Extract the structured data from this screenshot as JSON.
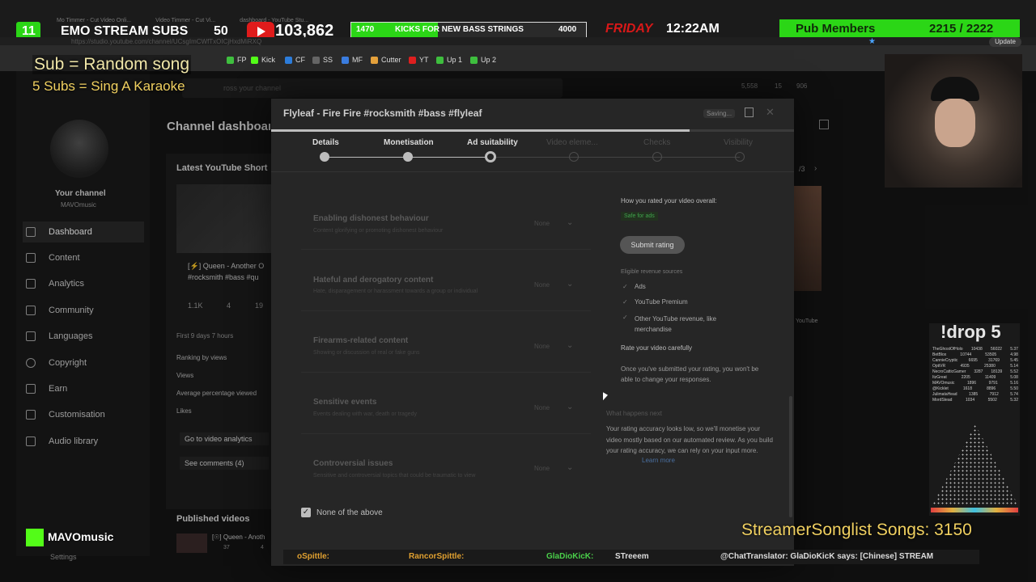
{
  "overlay": {
    "stream_subs": {
      "left_num": "11",
      "label": "EMO STREAM SUBS",
      "right_num": "50"
    },
    "youtube_count": "103,862",
    "kicks": {
      "left": "1470",
      "label": "KICKS FOR NEW BASS STRINGS",
      "right": "4000"
    },
    "day": "FRIDAY",
    "clock": "12:22AM",
    "pub_members": {
      "label": "Pub Members",
      "count": "2215 / 2222"
    },
    "tiny_tabs": [
      "Mo Timmer - Cut Video Onli...",
      "Video Timmer - Cut Vi...",
      "dashboard - YouTube Stu..."
    ],
    "url": "https://studio.youtube.com/channel/UCsgImCWfTxOICjHxdMiRXQ",
    "sub_line1": "Sub = Random song",
    "sub_line2": "5 Subs = Sing A Karaoke",
    "drop_title": "!drop 5",
    "leaderboard": [
      {
        "name": "TheGhostOfHolo",
        "a": "10438",
        "b": "56022",
        "c": "5.37"
      },
      {
        "name": "BetBlox",
        "a": "10744",
        "b": "53505",
        "c": "4.98"
      },
      {
        "name": "CannieCryptic",
        "a": "6695",
        "b": "31769",
        "c": "5.45"
      },
      {
        "name": "OptiVR",
        "a": "4935",
        "b": "25380",
        "c": "5.14"
      },
      {
        "name": "NecroCatticGamer",
        "a": "3287",
        "b": "18139",
        "c": "5.52"
      },
      {
        "name": "ItzGreat",
        "a": "2205",
        "b": "11409",
        "c": "5.08"
      },
      {
        "name": "MAVOmusic",
        "a": "1896",
        "b": "9791",
        "c": "5.16"
      },
      {
        "name": "@Kicklet",
        "a": "1618",
        "b": "8896",
        "c": "5.50"
      },
      {
        "name": "JulimataHead",
        "a": "1385",
        "b": "7912",
        "c": "5.74"
      },
      {
        "name": "MordStead",
        "a": "1034",
        "b": "5502",
        "c": "5.32"
      }
    ],
    "songlist": "StreamerSonglist Songs: 3150",
    "streamer_name": "MAVOmusic",
    "ticker": [
      "oSpittle:",
      "RancorSpittle:",
      "GlaDioKicK:",
      "STreeem",
      "@ChatTranslator: GlaDioKicK says: [Chinese] STREAM"
    ]
  },
  "bookmarks": [
    {
      "label": "FP",
      "color": "#3fbf3f"
    },
    {
      "label": "Kick",
      "color": "#53fc18"
    },
    {
      "label": "CF",
      "color": "#2d7ddb"
    },
    {
      "label": "SS",
      "color": "#666666"
    },
    {
      "label": "MF",
      "color": "#3b7de0"
    },
    {
      "label": "Cutter",
      "color": "#e6a23c"
    },
    {
      "label": "YT",
      "color": "#e02020"
    },
    {
      "label": "Up 1",
      "color": "#3fbf3f"
    },
    {
      "label": "Up 2",
      "color": "#3fbf3f"
    }
  ],
  "browser_update": "Update",
  "studio": {
    "search_placeholder": "ross your channel",
    "header_stats": {
      "views": "5,558",
      "subs": "15",
      "other": "906"
    },
    "channel_label": "Your channel",
    "channel_sub": "MAVOmusic",
    "nav": [
      "Dashboard",
      "Content",
      "Analytics",
      "Community",
      "Languages",
      "Copyright",
      "Earn",
      "Customisation",
      "Audio library"
    ],
    "settings": "Settings",
    "dashboard_title": "Channel dashboard",
    "latest_shorts": "Latest YouTube Short",
    "short_title": "[⚡] Queen - Another O #rocksmith #bass #qu",
    "short_stats": [
      "1.1K",
      "4",
      "19"
    ],
    "first_days": "First 9 days 7 hours",
    "ranking": "Ranking by views",
    "metrics": [
      "Views",
      "Average percentage viewed",
      "Likes"
    ],
    "go_analytics": "Go to video analytics",
    "see_comments": "See comments (4)",
    "published": "Published videos",
    "pub_item": "[☉] Queen - Anoth",
    "pub_stats": [
      "37",
      "4"
    ],
    "pager": "/3",
    "right_card": "YouTube"
  },
  "modal": {
    "title": "Flyleaf - Fire Fire #rocksmith #bass #flyleaf",
    "saving": "Saving...",
    "steps": [
      "Details",
      "Monetisation",
      "Ad suitability",
      "Video eleme...",
      "Checks",
      "Visibility"
    ],
    "items": [
      {
        "title": "Enabling dishonest behaviour",
        "sub": "Content glorifying or promoting dishonest behaviour",
        "value": "None"
      },
      {
        "title": "Hateful and derogatory content",
        "sub": "Hate, disparagement or harassment towards a group or individual",
        "value": "None"
      },
      {
        "title": "Firearms-related content",
        "sub": "Showing or discussion of real or fake guns",
        "value": "None"
      },
      {
        "title": "Sensitive events",
        "sub": "Events dealing with war, death or tragedy",
        "value": "None"
      },
      {
        "title": "Controversial issues",
        "sub": "Sensitive and controversial topics that could be traumatic to view",
        "value": "None"
      }
    ],
    "none_above": "None of the above",
    "rated_heading": "How you rated your video overall:",
    "safe_for_ads": "Safe for ads",
    "submit_rating": "Submit rating",
    "eligible": "Eligible revenue sources",
    "sources": [
      "Ads",
      "YouTube Premium",
      "Other YouTube revenue, like merchandise"
    ],
    "rate_carefully": "Rate your video carefully",
    "rate_note": "Once you've submitted your rating, you won't be able to change your responses.",
    "what_next": "What happens next",
    "accuracy": "Your rating accuracy looks low, so we'll monetise your video mostly based on our automated review. As you build your rating accuracy, we can rely on your input more.",
    "learn_more": "Learn more"
  }
}
